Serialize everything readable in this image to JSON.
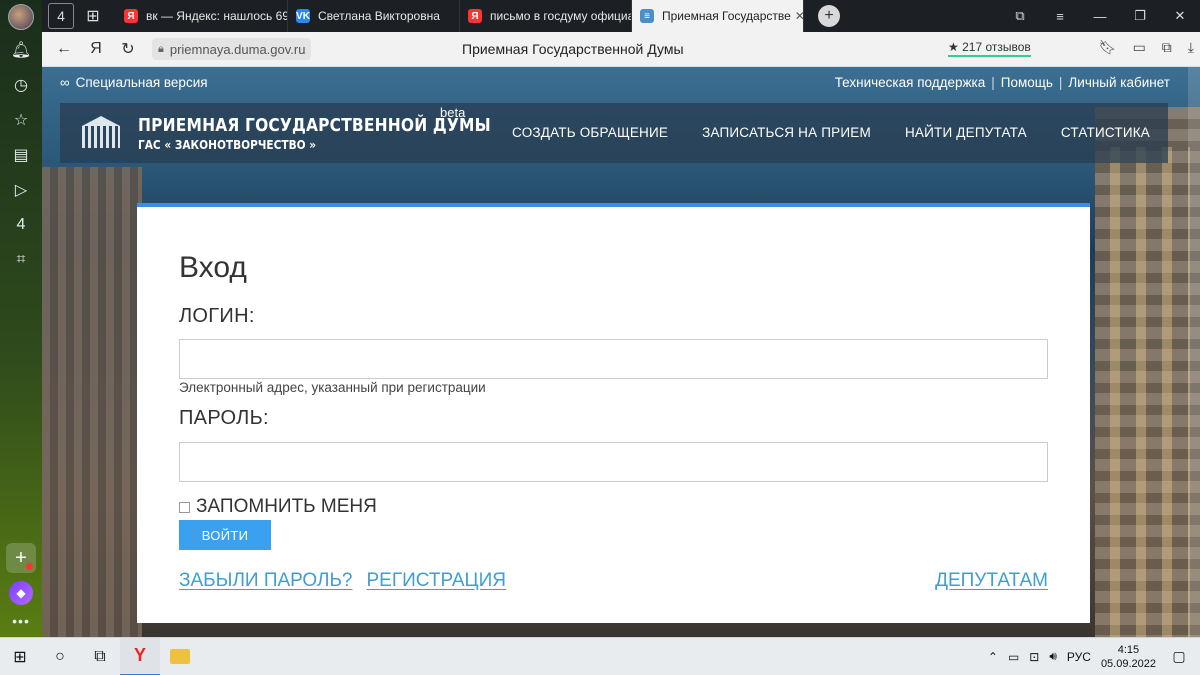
{
  "browser": {
    "tabs": [
      {
        "label": "вк — Яндекс: нашлось 69",
        "favicon": "yandex-icon",
        "color": "#ff3333",
        "glyph": "Я"
      },
      {
        "label": "Светлана Викторовна",
        "favicon": "vk-icon",
        "color": "#2787f5",
        "glyph": "VK"
      },
      {
        "label": "письмо в госдуму официа",
        "favicon": "yandex-icon",
        "color": "#ff3333",
        "glyph": "Я"
      },
      {
        "label": "Приемная Государстве",
        "favicon": "duma-icon",
        "color": "#4a90c8",
        "glyph": "≡",
        "active": true
      }
    ],
    "tab_counter": "4",
    "url": "priemnaya.duma.gov.ru",
    "page_title": "Приемная Государственной Думы",
    "reviews": "★ 217 отзывов"
  },
  "sidebar": {
    "counter": "4"
  },
  "site": {
    "special_version": "Специальная версия",
    "top_links": [
      "Техническая поддержка",
      "Помощь",
      "Личный кабинет"
    ],
    "brand_line1": "ПРИЕМНАЯ ГОСУДАРСТВЕННОЙ ДУМЫ",
    "brand_line2": "ГАС « ЗАКОНОТВОРЧЕСТВО »",
    "beta": "beta",
    "nav": [
      "СОЗДАТЬ ОБРАЩЕНИЕ",
      "ЗАПИСАТЬСЯ НА ПРИЕМ",
      "НАЙТИ ДЕПУТАТА",
      "СТАТИСТИКА"
    ]
  },
  "login": {
    "title": "Вход",
    "login_label": "ЛОГИН:",
    "login_value": "",
    "login_hint": "Электронный адрес, указанный при регистрации",
    "password_label": "ПАРОЛЬ:",
    "password_value": "",
    "remember_label": "ЗАПОМНИТЬ МЕНЯ",
    "remember_checked": false,
    "submit_label": "ВОЙТИ",
    "forgot_link": "ЗАБЫЛИ ПАРОЛЬ?",
    "register_link": "РЕГИСТРАЦИЯ",
    "deputies_link": "ДЕПУТАТАМ"
  },
  "taskbar": {
    "language": "РУС",
    "time": "4:15",
    "date": "05.09.2022"
  },
  "colors": {
    "accent": "#3d8ee0",
    "button": "#3aa1f0",
    "link": "#3f9fd0"
  }
}
